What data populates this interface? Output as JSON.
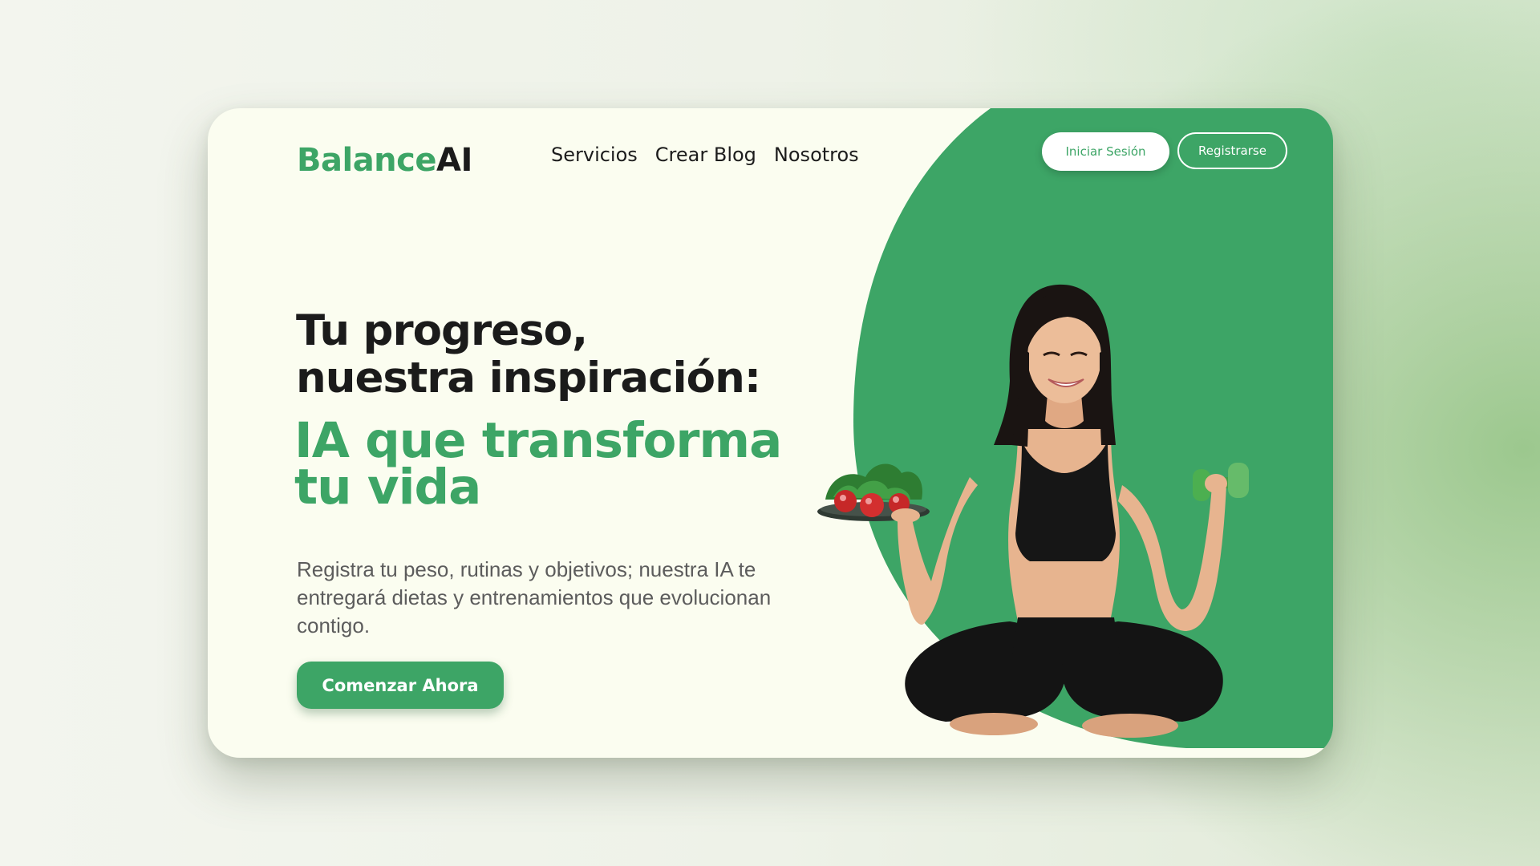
{
  "brand": {
    "part1": "Balance",
    "part2": "AI"
  },
  "nav": {
    "items": [
      {
        "label": "Servicios"
      },
      {
        "label": "Crear Blog"
      },
      {
        "label": "Nosotros"
      }
    ]
  },
  "auth": {
    "login_label": "Iniciar Sesión",
    "register_label": "Registrarse"
  },
  "hero": {
    "title_line1": "Tu progreso,",
    "title_line2": "nuestra inspiración:",
    "accent_line1": "IA que transforma",
    "accent_line2": "tu vida",
    "description": "Registra tu peso, rutinas y objetivos; nuestra IA te entregará dietas y entrenamientos que evolucionan contigo.",
    "cta_label": "Comenzar Ahora",
    "image_icon": "woman-meditating-with-salad-and-dumbbell-photo"
  },
  "colors": {
    "accent": "#3da566",
    "card_bg": "#fbfdf0",
    "text_dark": "#1b1b1b",
    "text_muted": "#5c5c5c"
  }
}
